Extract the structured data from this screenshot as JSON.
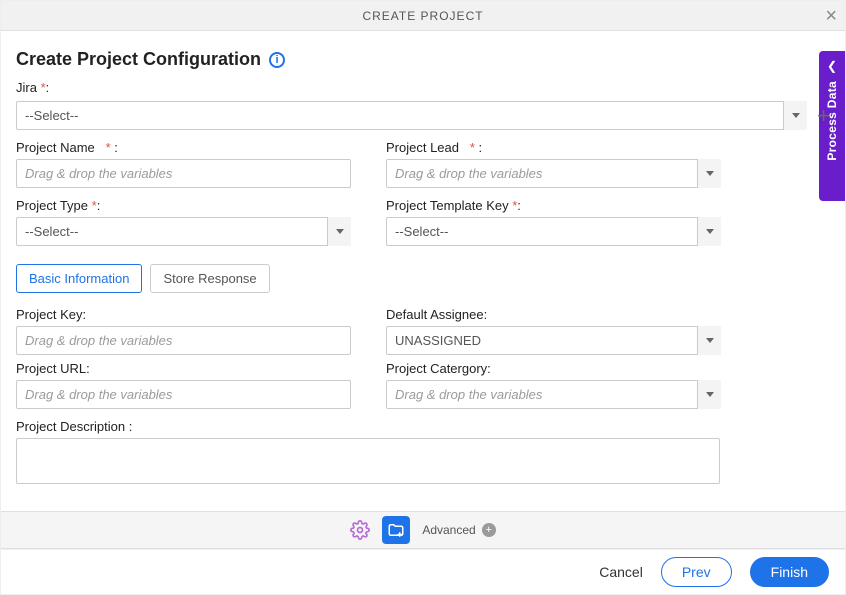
{
  "header": {
    "title": "CREATE PROJECT"
  },
  "sidepanel": {
    "label": "Process Data"
  },
  "config": {
    "title": "Create Project Configuration",
    "jira_label": "Jira",
    "jira_value": "--Select--",
    "left": {
      "project_name_label": "Project Name",
      "project_name_placeholder": "Drag & drop the variables",
      "project_type_label": "Project Type",
      "project_type_value": "--Select--"
    },
    "right": {
      "project_lead_label": "Project Lead",
      "project_lead_placeholder": "Drag & drop the variables",
      "template_key_label": "Project Template Key",
      "template_key_value": "--Select--"
    },
    "tabs": {
      "basic": "Basic Information",
      "store": "Store Response"
    },
    "basic": {
      "project_key_label": "Project Key:",
      "project_key_placeholder": "Drag & drop the variables",
      "project_url_label": "Project URL:",
      "project_url_placeholder": "Drag & drop the variables",
      "default_assignee_label": "Default Assignee:",
      "default_assignee_value": "UNASSIGNED",
      "project_category_label": "Project Catergory:",
      "project_category_placeholder": "Drag & drop the variables",
      "project_description_label": "Project Description :"
    }
  },
  "bottom": {
    "advanced": "Advanced"
  },
  "footer": {
    "cancel": "Cancel",
    "prev": "Prev",
    "finish": "Finish"
  }
}
